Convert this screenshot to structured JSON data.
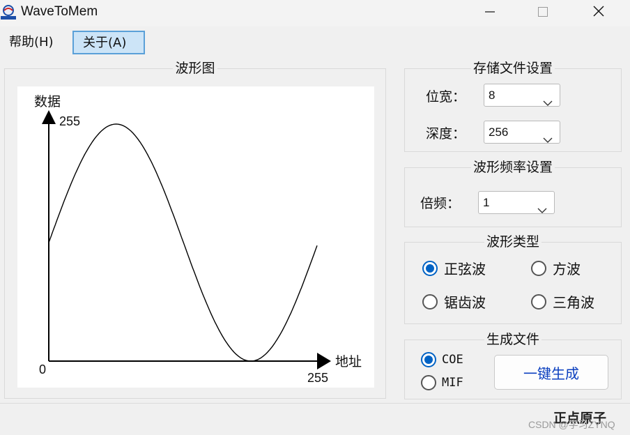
{
  "window": {
    "title": "WaveToMem",
    "icon_text": "正点原子"
  },
  "menu": {
    "help": "帮助(H)",
    "about": "关于(A)"
  },
  "waveform_panel": {
    "title": "波形图",
    "y_axis_label": "数据",
    "x_axis_label": "地址",
    "y_max_label": "255",
    "origin_label": "0",
    "x_max_label": "255",
    "waveform_type": "sine"
  },
  "storage_settings": {
    "title": "存储文件设置",
    "width_label": "位宽：",
    "width_value": "8",
    "depth_label": "深度：",
    "depth_value": "256"
  },
  "frequency_settings": {
    "title": "波形频率设置",
    "multiplier_label": "倍频：",
    "multiplier_value": "1"
  },
  "waveform_type": {
    "title": "波形类型",
    "options": [
      {
        "label": "正弦波",
        "checked": true
      },
      {
        "label": "方波",
        "checked": false
      },
      {
        "label": "锯齿波",
        "checked": false
      },
      {
        "label": "三角波",
        "checked": false
      }
    ]
  },
  "generate": {
    "title": "生成文件",
    "format_options": [
      {
        "label": "COE",
        "checked": true
      },
      {
        "label": "MIF",
        "checked": false
      }
    ],
    "button_label": "一键生成"
  },
  "statusbar": {
    "brand": "正点原子",
    "watermark": "CSDN @学习ZYNQ"
  },
  "colors": {
    "accent": "#0062c4",
    "button_text": "#0b3fbf",
    "menu_highlight": "#cce4f7"
  }
}
